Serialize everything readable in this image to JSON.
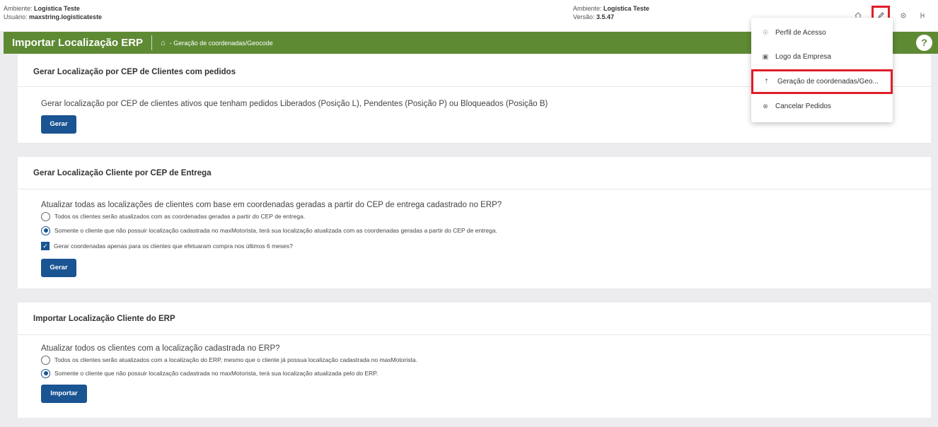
{
  "topbar": {
    "env_label": "Ambiente:",
    "env_value": "Logística Teste",
    "user_label": "Usuário:",
    "user_value": "maxstring.logisticateste",
    "env2_label": "Ambiente:",
    "env2_value": "Logística Teste",
    "version_label": "Versão:",
    "version_value": "3.5.47",
    "icons": [
      "home-icon",
      "pencil-icon",
      "gear-icon",
      "user-network-icon"
    ]
  },
  "header": {
    "title": "Importar Localização ERP",
    "home_glyph": "⌂",
    "breadcrumb": "- Geração de coordenadas/Geocode",
    "help": "?"
  },
  "menu": {
    "items": [
      {
        "icon": "user-icon",
        "glyph": "☉",
        "label": "Perfil de Acesso"
      },
      {
        "icon": "image-icon",
        "glyph": "▣",
        "label": "Logo da Empresa"
      },
      {
        "icon": "upload-icon",
        "glyph": "⇡",
        "label": "Geração de coordenadas/Geo..."
      },
      {
        "icon": "cancel-icon",
        "glyph": "⊗",
        "label": "Cancelar Pedidos"
      }
    ]
  },
  "section1": {
    "title": "Gerar Localização por CEP de Clientes com pedidos",
    "question": "Gerar localização por CEP de clientes ativos que tenham pedidos Liberados (Posição L), Pendentes (Posição P) ou Bloqueados (Posição B)",
    "button": "Gerar"
  },
  "section2": {
    "title": "Gerar Localização Cliente por CEP de Entrega",
    "question": "Atualizar todas as localizações de clientes com base em coordenadas geradas a partir do CEP de entrega cadastrado no ERP?",
    "option1": "Todos os clientes serão atualizados com as coordenadas geradas a partir do CEP de entrega.",
    "option2": "Somente o cliente que não possuir localização cadastrada no maxMotorista, terá sua localização atualizada com as coordenadas geradas a partir do CEP de entrega.",
    "checkbox": "Gerar coordenadas apenas para os clientes que efetuaram compra nos últimos 6 meses?",
    "button": "Gerar"
  },
  "section3": {
    "title": "Importar Localização Cliente do ERP",
    "question": "Atualizar todos os clientes com a localização cadastrada no ERP?",
    "option1": "Todos os clientes serão atualizados com a localização do ERP, mesmo que o cliente já possua localização cadastrada no maxMotorista.",
    "option2": "Somente o cliente que não possuir localização cadastrada no maxMotorista, terá sua localização atualizada pelo do ERP.",
    "button": "Importar"
  },
  "colors": {
    "brand_green": "#5e8a34",
    "button_blue": "#1a5493",
    "highlight_red": "#e01e2b"
  }
}
